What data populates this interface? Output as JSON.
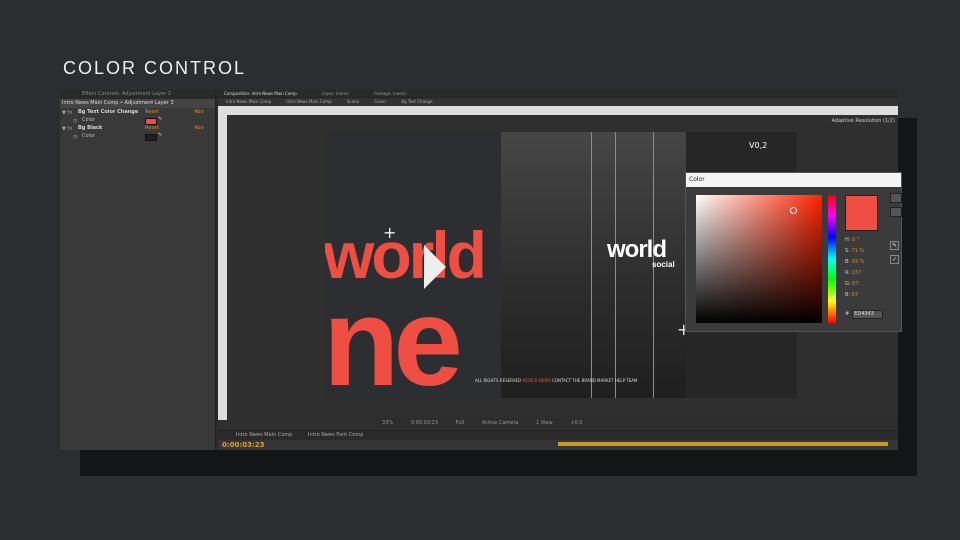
{
  "slide": {
    "title": "COLOR CONTROL"
  },
  "effect_controls": {
    "tab_label": "Effect Controls: Adjustment Layer 3",
    "breadcrumb": "Intro News Main Comp • Adjustment Layer 3",
    "effects": [
      {
        "name": "Bg Text Color Change",
        "reset": "Reset",
        "about": "Abo",
        "param_label": "Color",
        "color": "#ef4f43"
      },
      {
        "name": "Bg Black",
        "reset": "Reset",
        "about": "Abo",
        "param_label": "Color",
        "color": "#1f1f1f"
      }
    ]
  },
  "composition": {
    "tabs": [
      "Composition: Intro News Main Comp",
      "Layer: (none)",
      "Footage: (none)"
    ],
    "breadcrumbs": [
      "Intro News Main Comp",
      "Intro News Main Comp",
      "Scene",
      "Cover",
      "Bg Text Change"
    ],
    "resolution_label": "Adaptive Resolution (1/2)",
    "viewer": {
      "big_text_1": "world",
      "big_text_2": "ne",
      "center_word": "world",
      "center_sub": "social",
      "version_label": "V0,2",
      "footer_prefix": "ALL RIGHTS RESERVED",
      "footer_red": "WORLD NEWS",
      "footer_suffix": "CONTACT THE BRAND MARKET HELP TEAM"
    },
    "view_bar": [
      "33%",
      "0:00:03:23",
      "Full",
      "Active Camera",
      "1 View",
      "+0.0"
    ]
  },
  "color_picker": {
    "title": "Color",
    "fields": [
      {
        "label": "H:",
        "value": "0 °"
      },
      {
        "label": "S:",
        "value": "71 %"
      },
      {
        "label": "B:",
        "value": "93 %"
      },
      {
        "label": "R:",
        "value": "237"
      },
      {
        "label": "G:",
        "value": "67"
      },
      {
        "label": "B:",
        "value": "67"
      }
    ],
    "hex_label": "#",
    "hex_value": "ED4343",
    "current_color": "#ef4f43"
  },
  "timeline": {
    "tabs": [
      "Intro News Main Comp",
      "Intro News Font Comp"
    ],
    "timecode": "0:00:03:23"
  }
}
